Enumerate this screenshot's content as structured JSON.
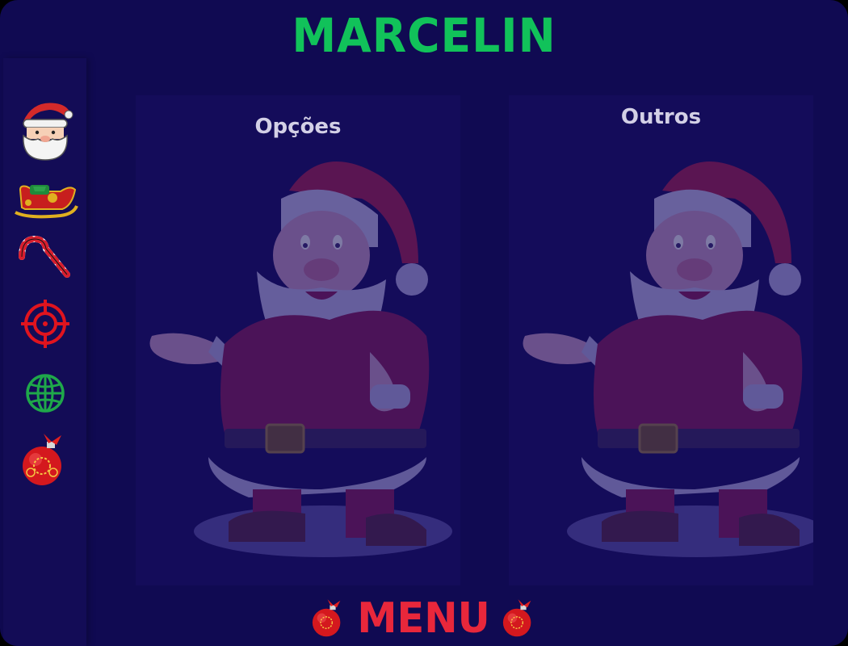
{
  "app": {
    "title": "MARCELIN",
    "title_color": "#11c25a",
    "background": "#100a52"
  },
  "sidebar": {
    "items": [
      {
        "icon": "santa-face-icon"
      },
      {
        "icon": "sleigh-icon"
      },
      {
        "icon": "candy-cane-icon"
      },
      {
        "icon": "crosshair-icon"
      },
      {
        "icon": "globe-icon"
      },
      {
        "icon": "ornament-icon"
      }
    ]
  },
  "panels": {
    "left": {
      "title": "Opções"
    },
    "right": {
      "title": "Outros"
    }
  },
  "footer": {
    "label": "MENU",
    "label_color": "#e8273b",
    "icon": "ornament-icon"
  }
}
